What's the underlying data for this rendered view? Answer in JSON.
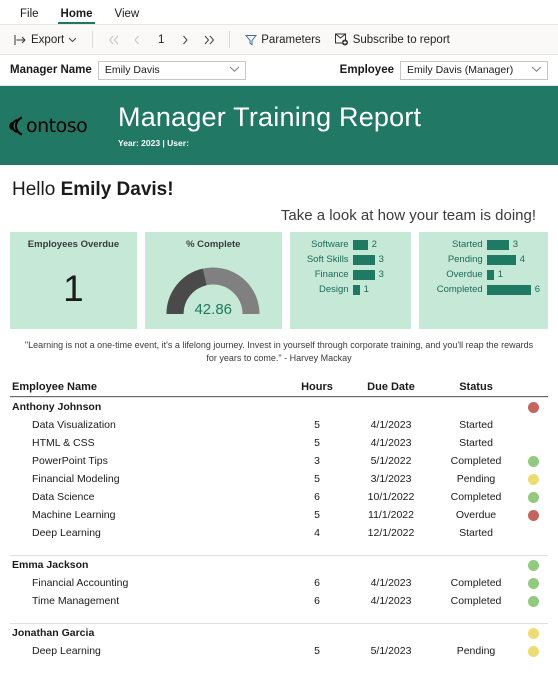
{
  "ribbon": {
    "tabs": [
      {
        "label": "File",
        "active": false
      },
      {
        "label": "Home",
        "active": true
      },
      {
        "label": "View",
        "active": false
      }
    ]
  },
  "toolbar": {
    "export_label": "Export",
    "export_icon": "export-arrow-icon",
    "first_page_icon": "first-page-icon",
    "prev_page_icon": "previous-page-icon",
    "page_number": "1",
    "next_page_icon": "next-page-icon",
    "last_page_icon": "last-page-icon",
    "parameters_label": "Parameters",
    "parameters_icon": "funnel-icon",
    "subscribe_label": "Subscribe to report",
    "subscribe_icon": "subscribe-mail-plus-icon"
  },
  "parameters": {
    "manager": {
      "label": "Manager Name",
      "value": "Emily Davis",
      "chevron_icon": "chevron-down-icon"
    },
    "employee": {
      "label": "Employee",
      "value": "Emily Davis (Manager)",
      "chevron_icon": "chevron-down-icon"
    }
  },
  "banner": {
    "logo_text": "ontoso",
    "logo_icon": "contoso-arcs-icon",
    "title": "Manager Training Report",
    "subtitle": "Year: 2023 | User:",
    "background_color": "#217864"
  },
  "body": {
    "greeting_prefix": "Hello ",
    "greeting_name": "Emily Davis!",
    "tagline": "Take a look at how your team is doing!",
    "quote": "\"Learning is not a one-time event, it's a lifelong journey. Invest in yourself through corporate training, and you'll reap the rewards for years to come.\" - Harvey Mackay"
  },
  "cards": {
    "overdue": {
      "title": "Employees Overdue",
      "value": "1"
    },
    "complete": {
      "title": "% Complete",
      "value": "42.86"
    }
  },
  "chart_data": [
    {
      "type": "bar",
      "title": "% Complete",
      "subtype": "gauge",
      "value": 42.86,
      "ylim": [
        0,
        100
      ],
      "filled_color": "#4a4a4a",
      "track_color": "#808080",
      "value_label": "42.86"
    },
    {
      "type": "bar",
      "orientation": "horizontal",
      "title": "",
      "categories": [
        "Software",
        "Soft Skills",
        "Finance",
        "Design"
      ],
      "values": [
        2,
        3,
        3,
        1
      ],
      "xlabel": "",
      "ylabel": "",
      "xlim": [
        0,
        3
      ],
      "bar_color": "#1f7a63",
      "grid": false,
      "legend": "none"
    },
    {
      "type": "bar",
      "orientation": "horizontal",
      "title": "",
      "categories": [
        "Started",
        "Pending",
        "Overdue",
        "Completed"
      ],
      "values": [
        3,
        4,
        1,
        6
      ],
      "xlabel": "",
      "ylabel": "",
      "xlim": [
        0,
        6
      ],
      "bar_color": "#1f7a63",
      "grid": false,
      "legend": "none"
    }
  ],
  "table": {
    "headers": {
      "name": "Employee Name",
      "hours": "Hours",
      "due": "Due Date",
      "status": "Status"
    },
    "status_colors": {
      "completed": "#92c97e",
      "pending": "#ebdd72",
      "overdue": "#c4645f",
      "started": "transparent"
    },
    "groups": [
      {
        "name": "Anthony Johnson",
        "dot": "#c4645f",
        "rows": [
          {
            "name": "Data Visualization",
            "hours": "5",
            "due": "4/1/2023",
            "status": "Started",
            "dot": ""
          },
          {
            "name": "HTML & CSS",
            "hours": "5",
            "due": "4/1/2023",
            "status": "Started",
            "dot": ""
          },
          {
            "name": "PowerPoint Tips",
            "hours": "3",
            "due": "5/1/2022",
            "status": "Completed",
            "dot": "#92c97e"
          },
          {
            "name": "Financial Modeling",
            "hours": "5",
            "due": "3/1/2023",
            "status": "Pending",
            "dot": "#ebdd72"
          },
          {
            "name": "Data Science",
            "hours": "6",
            "due": "10/1/2022",
            "status": "Completed",
            "dot": "#92c97e"
          },
          {
            "name": "Machine Learning",
            "hours": "5",
            "due": "11/1/2022",
            "status": "Overdue",
            "dot": "#c4645f"
          },
          {
            "name": "Deep Learning",
            "hours": "4",
            "due": "12/1/2022",
            "status": "Started",
            "dot": ""
          }
        ]
      },
      {
        "name": "Emma Jackson",
        "dot": "#92c97e",
        "rows": [
          {
            "name": "Financial Accounting",
            "hours": "6",
            "due": "4/1/2023",
            "status": "Completed",
            "dot": "#92c97e"
          },
          {
            "name": "Time Management",
            "hours": "6",
            "due": "4/1/2023",
            "status": "Completed",
            "dot": "#92c97e"
          }
        ]
      },
      {
        "name": "Jonathan Garcia",
        "dot": "#ebdd72",
        "rows": [
          {
            "name": "Deep Learning",
            "hours": "5",
            "due": "5/1/2023",
            "status": "Pending",
            "dot": "#ebdd72"
          }
        ]
      }
    ]
  }
}
